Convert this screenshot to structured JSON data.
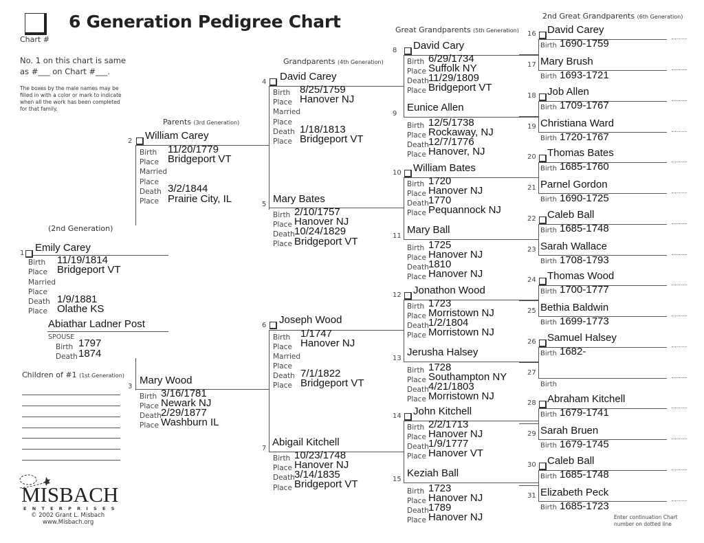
{
  "header": {
    "title": "6 Generation Pedigree Chart",
    "chart_number_label": "Chart #",
    "note_line1": "No. 1 on this chart is same",
    "note_line2": "as #___ on Chart #___.",
    "instructions": "The boxes by the male names may be filled in with a color or mark to indicate when all the work has been completed for that family."
  },
  "generation_labels": {
    "gen2": "(2nd Generation)",
    "gen3": "Parents",
    "gen3_sub": "(3rd Generation)",
    "gen4": "Grandparents",
    "gen4_sub": "(4th Generation)",
    "gen5": "Great Grandparents",
    "gen5_sub": "(5th Generation)",
    "gen6": "2nd Great Grandparents",
    "gen6_sub": "(6th Generation)",
    "children": "Children of #1",
    "children_sub": "(1st Generation)"
  },
  "field_labels": {
    "birth": "Birth",
    "place": "Place",
    "married": "Married",
    "death": "Death",
    "spouse": "SPOUSE"
  },
  "persons": {
    "p1": {
      "num": "1",
      "name": "Emily Carey",
      "birth": "11/19/1814",
      "birth_place": "Bridgeport VT",
      "married": "",
      "married_place": "",
      "death": "1/9/1881",
      "death_place": "Olathe KS"
    },
    "spouse": {
      "name": "Abiathar Ladner Post",
      "birth": "1797",
      "death": "1874"
    },
    "p2": {
      "num": "2",
      "name": "William Carey",
      "birth": "11/20/1779",
      "birth_place": "Bridgeport VT",
      "married": "",
      "married_place": "",
      "death": "3/2/1844",
      "death_place": "Prairie City, IL"
    },
    "p3": {
      "num": "3",
      "name": "Mary Wood",
      "birth": "3/16/1781",
      "birth_place": "Newark NJ",
      "death": "2/29/1877",
      "death_place": "Washburn IL"
    },
    "p4": {
      "num": "4",
      "name": "David Carey",
      "birth": "8/25/1759",
      "birth_place": "Hanover NJ",
      "married": "",
      "married_place": "",
      "death": "1/18/1813",
      "death_place": "Bridgeport VT"
    },
    "p5": {
      "num": "5",
      "name": "Mary Bates",
      "birth": "2/10/1757",
      "birth_place": "Hanover NJ",
      "death": "10/24/1829",
      "death_place": "Bridgeport VT"
    },
    "p6": {
      "num": "6",
      "name": "Joseph Wood",
      "birth": "1/1747",
      "birth_place": "Hanover NJ",
      "married": "",
      "married_place": "",
      "death": "7/1/1822",
      "death_place": "Bridgeport VT"
    },
    "p7": {
      "num": "7",
      "name": "Abigail Kitchell",
      "birth": "10/23/1748",
      "birth_place": "Hanover NJ",
      "death": "3/14/1835",
      "death_place": "Bridgeport VT"
    },
    "p8": {
      "num": "8",
      "name": "David Cary",
      "birth": "6/29/1734",
      "birth_place": "Suffolk NY",
      "death": "11/29/1809",
      "death_place": "Bridgeport VT"
    },
    "p9": {
      "num": "9",
      "name": "Eunice Allen",
      "birth": "12/5/1738",
      "birth_place": "Rockaway, NJ",
      "death": "12/7/1776",
      "death_place": "Hanover, NJ"
    },
    "p10": {
      "num": "10",
      "name": "William Bates",
      "birth": "1720",
      "birth_place": "Hanover NJ",
      "death": "1770",
      "death_place": "Pequannock NJ"
    },
    "p11": {
      "num": "11",
      "name": "Mary Ball",
      "birth": "1725",
      "birth_place": "Hanover NJ",
      "death": "1810",
      "death_place": "Hanover NJ"
    },
    "p12": {
      "num": "12",
      "name": "Jonathon Wood",
      "birth": "1723",
      "birth_place": "Morristown NJ",
      "death": "1/2/1804",
      "death_place": "Morristown NJ"
    },
    "p13": {
      "num": "13",
      "name": "Jerusha Halsey",
      "birth": "1728",
      "birth_place": "Southampton NY",
      "death": "4/21/1803",
      "death_place": "Morristown NJ"
    },
    "p14": {
      "num": "14",
      "name": "John Kitchell",
      "birth": "2/2/1713",
      "birth_place": "Hanover NJ",
      "death": "1/9/1777",
      "death_place": "Hanover VT"
    },
    "p15": {
      "num": "15",
      "name": "Keziah Ball",
      "birth": "1723",
      "birth_place": "Hanover NJ",
      "death": "1789",
      "death_place": "Hanover NJ"
    }
  },
  "gen6": [
    {
      "num": "16",
      "name": "David Carey",
      "birth": "1690-1759"
    },
    {
      "num": "17",
      "name": "Mary Brush",
      "birth": "1693-1721"
    },
    {
      "num": "18",
      "name": "Job Allen",
      "birth": "1709-1767"
    },
    {
      "num": "19",
      "name": "Christiana Ward",
      "birth": "1720-1767"
    },
    {
      "num": "20",
      "name": "Thomas Bates",
      "birth": "1685-1760"
    },
    {
      "num": "21",
      "name": "Parnel Gordon",
      "birth": "1690-1725"
    },
    {
      "num": "22",
      "name": "Caleb Ball",
      "birth": "1685-1748"
    },
    {
      "num": "23",
      "name": "Sarah Wallace",
      "birth": "1708-1793"
    },
    {
      "num": "24",
      "name": "Thomas Wood",
      "birth": "1700-1777"
    },
    {
      "num": "25",
      "name": "Bethia Baldwin",
      "birth": "1699-1773"
    },
    {
      "num": "26",
      "name": "Samuel Halsey",
      "birth": "1682-"
    },
    {
      "num": "27",
      "name": "",
      "birth": ""
    },
    {
      "num": "28",
      "name": "Abraham Kitchell",
      "birth": "1679-1741"
    },
    {
      "num": "29",
      "name": "Sarah Bruen",
      "birth": "1679-1745"
    },
    {
      "num": "30",
      "name": "Caleb Ball",
      "birth": "1685-1748"
    },
    {
      "num": "31",
      "name": "Elizabeth Peck",
      "birth": "1685-1723"
    }
  ],
  "footer": {
    "logo": "MISBACH",
    "logo_sub": "E N T E R P R I S E S",
    "copyright": "© 2002 Grant L. Misbach",
    "website": "www.Misbach.org",
    "continuation_note_line1": "Enter continuation Chart",
    "continuation_note_line2": "number on dotted line"
  }
}
